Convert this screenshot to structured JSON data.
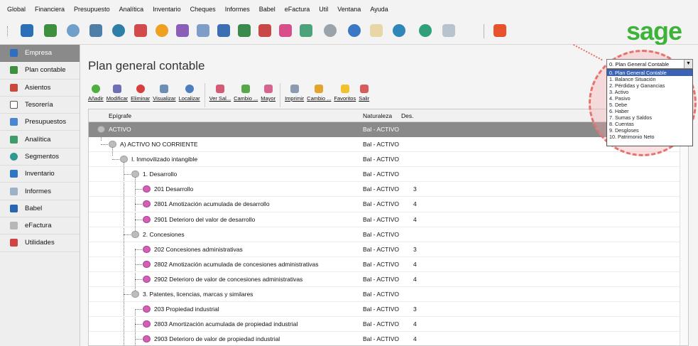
{
  "menu": [
    {
      "label": "Global"
    },
    {
      "label": "Financiera"
    },
    {
      "label": "Presupuesto"
    },
    {
      "label": "Analítica"
    },
    {
      "label": "Inventario"
    },
    {
      "label": "Cheques"
    },
    {
      "label": "Informes"
    },
    {
      "label": "Babel"
    },
    {
      "label": "eFactura"
    },
    {
      "label": "Util"
    },
    {
      "label": "Ventana"
    },
    {
      "label": "Ayuda"
    }
  ],
  "brand": "sage",
  "sidebar": {
    "items": [
      {
        "label": "Empresa",
        "active": true
      },
      {
        "label": "Plan contable"
      },
      {
        "label": "Asientos"
      },
      {
        "label": "Tesorería"
      },
      {
        "label": "Presupuestos"
      },
      {
        "label": "Analítica"
      },
      {
        "label": "Segmentos"
      },
      {
        "label": "Inventario"
      },
      {
        "label": "Informes"
      },
      {
        "label": "Babel"
      },
      {
        "label": "eFactura"
      },
      {
        "label": "Utilidades"
      }
    ]
  },
  "page": {
    "title": "Plan general contable"
  },
  "actions": [
    {
      "label": "Añadir"
    },
    {
      "label": "Modificar"
    },
    {
      "label": "Eliminar"
    },
    {
      "label": "Visualizar"
    },
    {
      "label": "Localizar"
    },
    {
      "label": "Ver Sal..."
    },
    {
      "label": "Cambio ..."
    },
    {
      "label": "Mayor"
    },
    {
      "label": "Imprimir"
    },
    {
      "label": "Cambio ..."
    },
    {
      "label": "Favoritos"
    },
    {
      "label": "Salir"
    }
  ],
  "table": {
    "headers": {
      "desc": "Epígrafe",
      "nat": "Naturaleza",
      "des": "Des."
    },
    "rows": [
      {
        "desc": "ACTIVO",
        "nat": "Bal - ACTIVO",
        "des": ""
      },
      {
        "desc": "A) ACTIVO NO CORRIENTE",
        "nat": "Bal - ACTIVO",
        "des": ""
      },
      {
        "desc": "I. Inmovilizado intangible",
        "nat": "Bal - ACTIVO",
        "des": ""
      },
      {
        "desc": "1. Desarrollo",
        "nat": "Bal - ACTIVO",
        "des": ""
      },
      {
        "desc": "201  Desarrollo",
        "nat": "Bal - ACTIVO",
        "des": "3"
      },
      {
        "desc": "2801  Amotización acumulada de desarrollo",
        "nat": "Bal - ACTIVO",
        "des": "4"
      },
      {
        "desc": "2901  Deterioro del valor de desarrollo",
        "nat": "Bal - ACTIVO",
        "des": "4"
      },
      {
        "desc": "2. Concesiones",
        "nat": "Bal - ACTIVO",
        "des": ""
      },
      {
        "desc": "202  Concesiones administrativas",
        "nat": "Bal - ACTIVO",
        "des": "3"
      },
      {
        "desc": "2802  Amotización acumulada de concesiones administrativas",
        "nat": "Bal - ACTIVO",
        "des": "4"
      },
      {
        "desc": "2902  Deterioro de valor de concesiones administrativas",
        "nat": "Bal - ACTIVO",
        "des": "4"
      },
      {
        "desc": "3. Patentes, licencias, marcas y similares",
        "nat": "Bal - ACTIVO",
        "des": ""
      },
      {
        "desc": "203  Propiedad industrial",
        "nat": "Bal - ACTIVO",
        "des": "3"
      },
      {
        "desc": "2803  Amortización acumulada de propiedad industrial",
        "nat": "Bal - ACTIVO",
        "des": "4"
      },
      {
        "desc": "2903  Deterioro de valor de propiedad industrial",
        "nat": "Bal - ACTIVO",
        "des": "4"
      }
    ]
  },
  "dropdown": {
    "selected": "0. Plan General Contable",
    "options": [
      "0. Plan General Contable",
      "1. Balance Situación",
      "2. Pérdidas y Ganancias",
      "3. Activo",
      "4. Pasivo",
      "5. Debe",
      "6. Haber",
      "7. Sumas y Saldos",
      "8. Cuentas",
      "9. Desgloses",
      "10. Patrimonio Neto"
    ]
  }
}
